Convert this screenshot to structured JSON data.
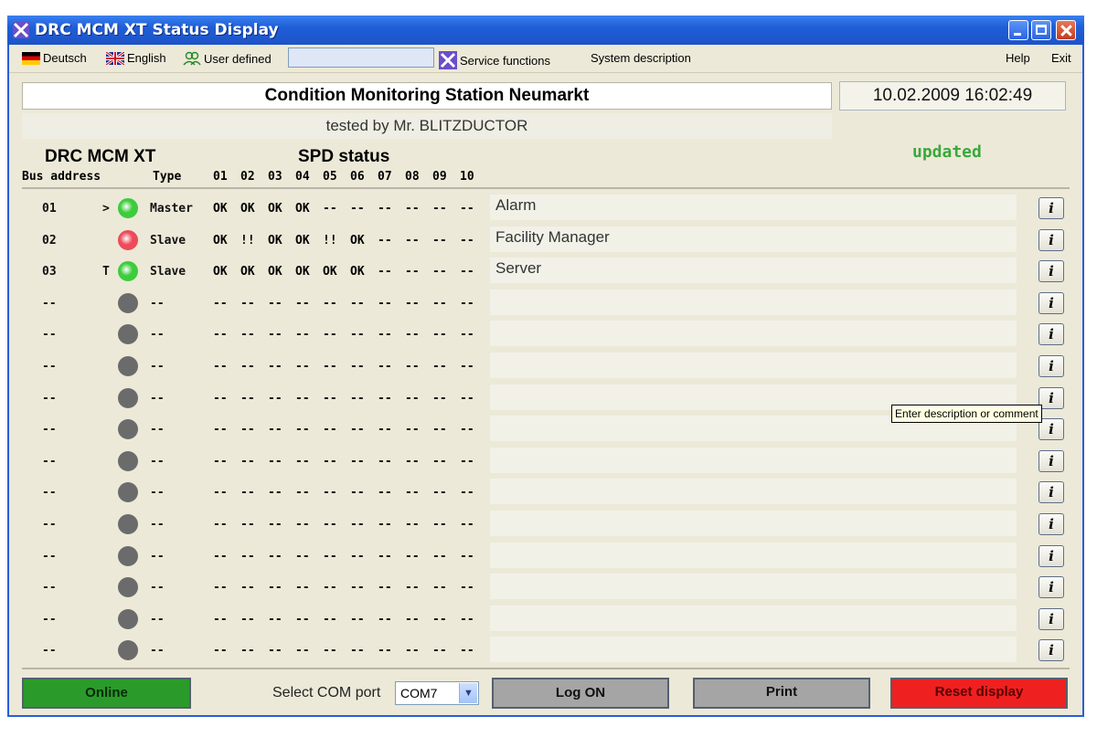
{
  "window": {
    "title": "DRC MCM XT Status Display"
  },
  "menu": {
    "deutsch": "Deutsch",
    "english": "English",
    "user_defined": "User defined",
    "service_functions": "Service functions",
    "system_description": "System description",
    "help": "Help",
    "exit": "Exit"
  },
  "header": {
    "station": "Condition Monitoring Station Neumarkt",
    "subtitle": "tested by Mr. BLITZDUCTOR",
    "datetime": "10.02.2009  16:02:49",
    "device": "DRC MCM XT",
    "spd_status": "SPD status",
    "updated": "updated"
  },
  "columns": {
    "bus_address": "Bus address",
    "type": "Type",
    "spd": [
      "01",
      "02",
      "03",
      "04",
      "05",
      "06",
      "07",
      "08",
      "09",
      "10"
    ]
  },
  "led_colors": {
    "green": "#3ccc3c",
    "red": "#ee4a5a",
    "gray": "#6b6b6b"
  },
  "rows": [
    {
      "address": "01",
      "marker": ">",
      "led": "green",
      "type": "Master",
      "spd": [
        "OK",
        "OK",
        "OK",
        "OK",
        "--",
        "--",
        "--",
        "--",
        "--",
        "--"
      ],
      "description": "Alarm"
    },
    {
      "address": "02",
      "marker": "",
      "led": "red",
      "type": "Slave",
      "spd": [
        "OK",
        "!!",
        "OK",
        "OK",
        "!!",
        "OK",
        "--",
        "--",
        "--",
        "--"
      ],
      "description": "Facility Manager"
    },
    {
      "address": "03",
      "marker": "T",
      "led": "green",
      "type": "Slave",
      "spd": [
        "OK",
        "OK",
        "OK",
        "OK",
        "OK",
        "OK",
        "--",
        "--",
        "--",
        "--"
      ],
      "description": "Server"
    },
    {
      "address": "--",
      "marker": "",
      "led": "gray",
      "type": "--",
      "spd": [
        "--",
        "--",
        "--",
        "--",
        "--",
        "--",
        "--",
        "--",
        "--",
        "--"
      ],
      "description": ""
    },
    {
      "address": "--",
      "marker": "",
      "led": "gray",
      "type": "--",
      "spd": [
        "--",
        "--",
        "--",
        "--",
        "--",
        "--",
        "--",
        "--",
        "--",
        "--"
      ],
      "description": ""
    },
    {
      "address": "--",
      "marker": "",
      "led": "gray",
      "type": "--",
      "spd": [
        "--",
        "--",
        "--",
        "--",
        "--",
        "--",
        "--",
        "--",
        "--",
        "--"
      ],
      "description": ""
    },
    {
      "address": "--",
      "marker": "",
      "led": "gray",
      "type": "--",
      "spd": [
        "--",
        "--",
        "--",
        "--",
        "--",
        "--",
        "--",
        "--",
        "--",
        "--"
      ],
      "description": ""
    },
    {
      "address": "--",
      "marker": "",
      "led": "gray",
      "type": "--",
      "spd": [
        "--",
        "--",
        "--",
        "--",
        "--",
        "--",
        "--",
        "--",
        "--",
        "--"
      ],
      "description": ""
    },
    {
      "address": "--",
      "marker": "",
      "led": "gray",
      "type": "--",
      "spd": [
        "--",
        "--",
        "--",
        "--",
        "--",
        "--",
        "--",
        "--",
        "--",
        "--"
      ],
      "description": ""
    },
    {
      "address": "--",
      "marker": "",
      "led": "gray",
      "type": "--",
      "spd": [
        "--",
        "--",
        "--",
        "--",
        "--",
        "--",
        "--",
        "--",
        "--",
        "--"
      ],
      "description": ""
    },
    {
      "address": "--",
      "marker": "",
      "led": "gray",
      "type": "--",
      "spd": [
        "--",
        "--",
        "--",
        "--",
        "--",
        "--",
        "--",
        "--",
        "--",
        "--"
      ],
      "description": ""
    },
    {
      "address": "--",
      "marker": "",
      "led": "gray",
      "type": "--",
      "spd": [
        "--",
        "--",
        "--",
        "--",
        "--",
        "--",
        "--",
        "--",
        "--",
        "--"
      ],
      "description": ""
    },
    {
      "address": "--",
      "marker": "",
      "led": "gray",
      "type": "--",
      "spd": [
        "--",
        "--",
        "--",
        "--",
        "--",
        "--",
        "--",
        "--",
        "--",
        "--"
      ],
      "description": ""
    },
    {
      "address": "--",
      "marker": "",
      "led": "gray",
      "type": "--",
      "spd": [
        "--",
        "--",
        "--",
        "--",
        "--",
        "--",
        "--",
        "--",
        "--",
        "--"
      ],
      "description": ""
    },
    {
      "address": "--",
      "marker": "",
      "led": "gray",
      "type": "--",
      "spd": [
        "--",
        "--",
        "--",
        "--",
        "--",
        "--",
        "--",
        "--",
        "--",
        "--"
      ],
      "description": ""
    }
  ],
  "info_button": "i",
  "tooltip": "Enter description or comment",
  "bottom": {
    "online": "Online",
    "com_label": "Select COM port",
    "com_value": "COM7",
    "log_on": "Log ON",
    "print": "Print",
    "reset": "Reset display"
  }
}
